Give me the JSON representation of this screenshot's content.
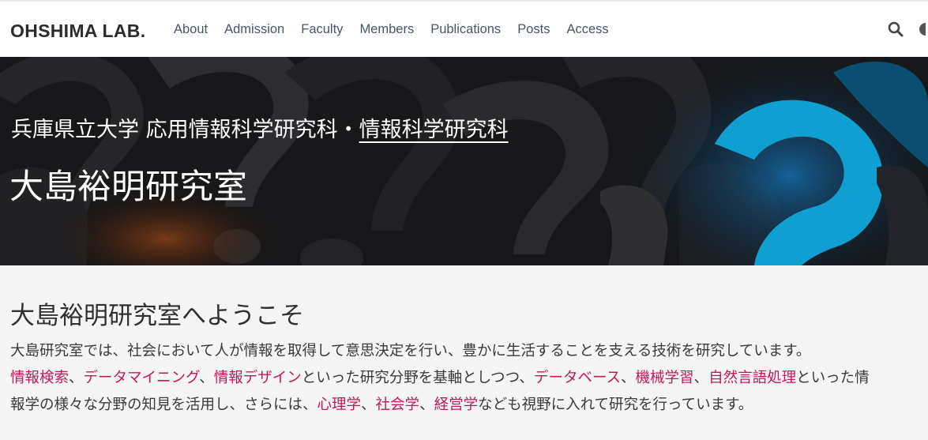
{
  "navbar": {
    "brand": "OHSHIMA LAB.",
    "links": [
      "About",
      "Admission",
      "Faculty",
      "Members",
      "Publications",
      "Posts",
      "Access"
    ],
    "search_icon": "search-icon",
    "theme_icon": "half-moon-icon"
  },
  "hero": {
    "subtitle_prefix": "兵庫県立大学 応用情報科学研究科・",
    "subtitle_link": "情報科学研究科",
    "title": "大島裕明研究室"
  },
  "welcome": {
    "heading": "大島裕明研究室へようこそ",
    "line1": "大島研究室では、社会において人が情報を取得して意思決定を行い、豊かに生活することを支える技術を研究しています。",
    "line2": {
      "kw1": "情報検索",
      "sep1": "、",
      "kw2": "データマイニング",
      "sep2": "、",
      "kw3": "情報デザイン",
      "mid": "といった研究分野を基軸としつつ、",
      "kw4": "データベース",
      "sep3": "、",
      "kw5": "機械学習",
      "sep4": "、",
      "kw6": "自然言語処理",
      "end": "といった情"
    },
    "line3": {
      "start": "報学の様々な分野の知見を活用し、さらには、",
      "kw1": "心理学",
      "sep1": "、",
      "kw2": "社会学",
      "sep2": "、",
      "kw3": "経営学",
      "end": "なども視野に入れて研究を行っています。"
    }
  },
  "colors": {
    "keyword": "#c2185b",
    "accent_blue": "#1ab8f0",
    "navbar_bg": "#ffffff",
    "content_bg": "#f5f5f5"
  }
}
